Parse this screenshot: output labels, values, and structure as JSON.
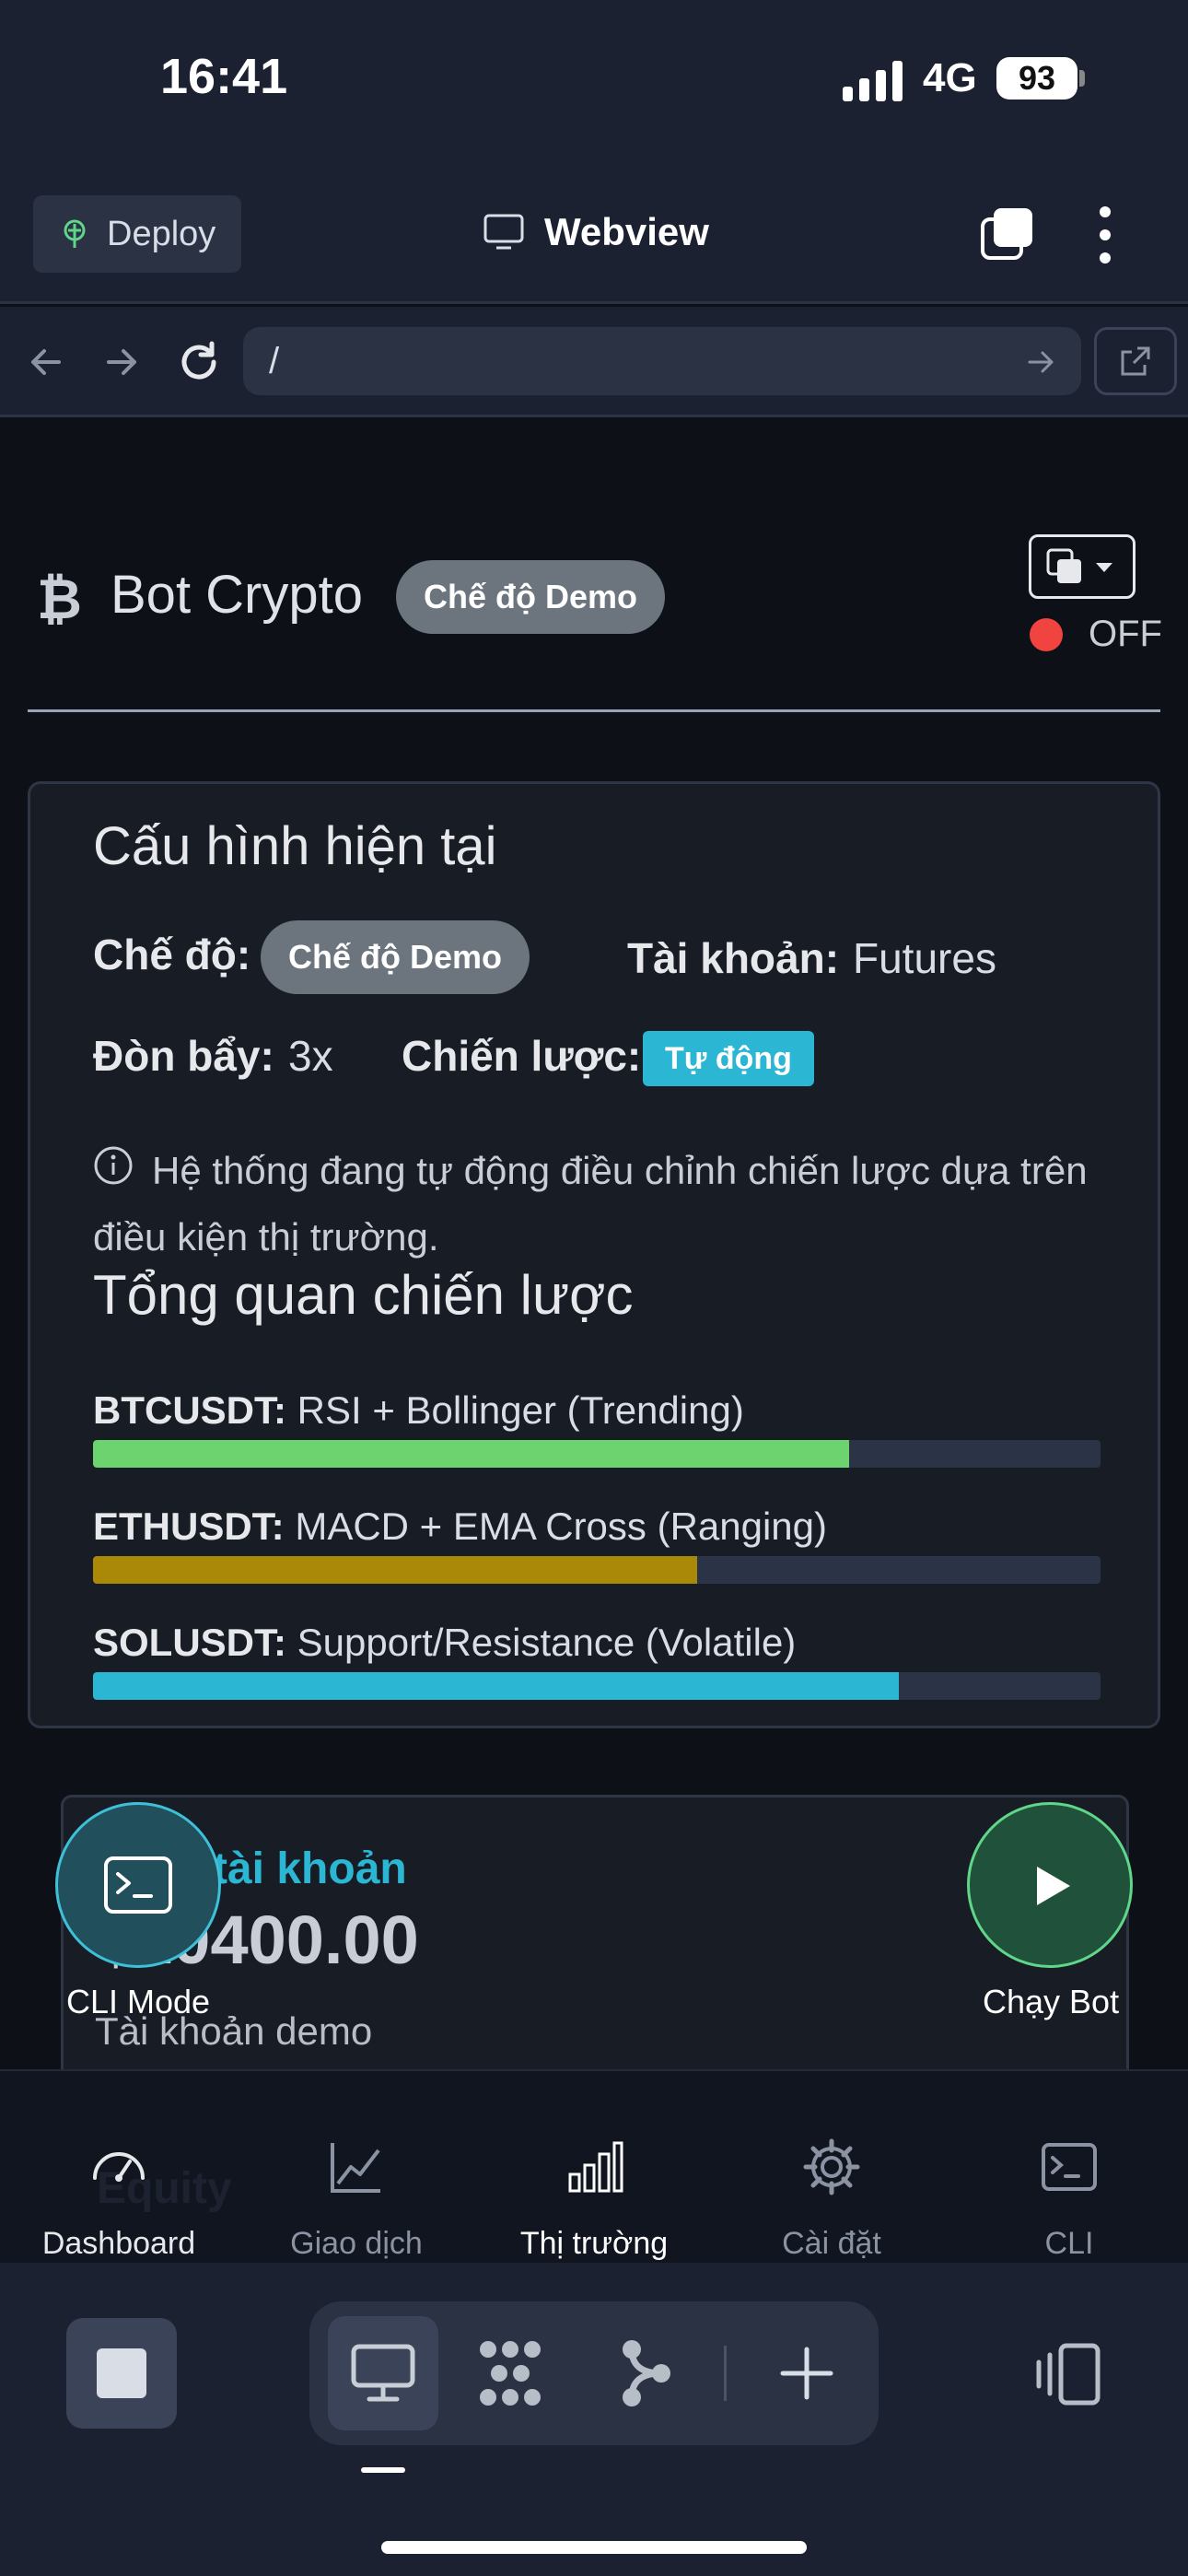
{
  "status_bar": {
    "time": "16:41",
    "network": "4G",
    "battery": "93"
  },
  "app_header": {
    "deploy_label": "Deploy",
    "title": "Webview"
  },
  "url_bar": {
    "url": "/"
  },
  "page": {
    "brand_name": "Bot Crypto",
    "brand_symbol": "₿",
    "mode_badge": "Chế độ Demo",
    "bot_status": "OFF",
    "config": {
      "title": "Cấu hình hiện tại",
      "mode_label": "Chế độ:",
      "mode_value": "Chế độ Demo",
      "account_label": "Tài khoản:",
      "account_value": "Futures",
      "leverage_label": "Đòn bẩy:",
      "leverage_value": "3x",
      "strategy_label": "Chiến lược:",
      "strategy_value": "Tự động",
      "info_text": "Hệ thống đang tự động điều chỉnh chiến lược dựa trên điều kiện thị trường."
    },
    "overview": {
      "title": "Tổng quan chiến lược",
      "items": [
        {
          "symbol": "BTCUSDT:",
          "strategy": "RSI + Bollinger (Trending)",
          "progress": 0.75,
          "color": "#6dd36f"
        },
        {
          "symbol": "ETHUSDT:",
          "strategy": "MACD + EMA Cross (Ranging)",
          "progress": 0.6,
          "color": "#a98907"
        },
        {
          "symbol": "SOLUSDT:",
          "strategy": "Support/Resistance (Volatile)",
          "progress": 0.8,
          "color": "#2bb6d3"
        }
      ]
    },
    "balance": {
      "title_partial": "tài khoản",
      "amount_partial": "$10400.00",
      "subtitle": "Tài khoản demo"
    },
    "fab": {
      "cli_label": "CLI Mode",
      "run_label": "Chạy Bot"
    },
    "ghost_text": "Equity"
  },
  "bottom_nav": [
    {
      "label": "Dashboard",
      "icon": "speedometer-icon",
      "active": false
    },
    {
      "label": "Giao dịch",
      "icon": "line-chart-icon",
      "active": false
    },
    {
      "label": "Thị trường",
      "icon": "bar-chart-icon",
      "active": true
    },
    {
      "label": "Cài đặt",
      "icon": "gear-icon",
      "active": false
    },
    {
      "label": "CLI",
      "icon": "terminal-icon",
      "active": false
    }
  ],
  "colors": {
    "accent": "#2bb6d3",
    "success": "#5fd68a",
    "danger": "#f1433f",
    "badge": "#6c757d"
  }
}
